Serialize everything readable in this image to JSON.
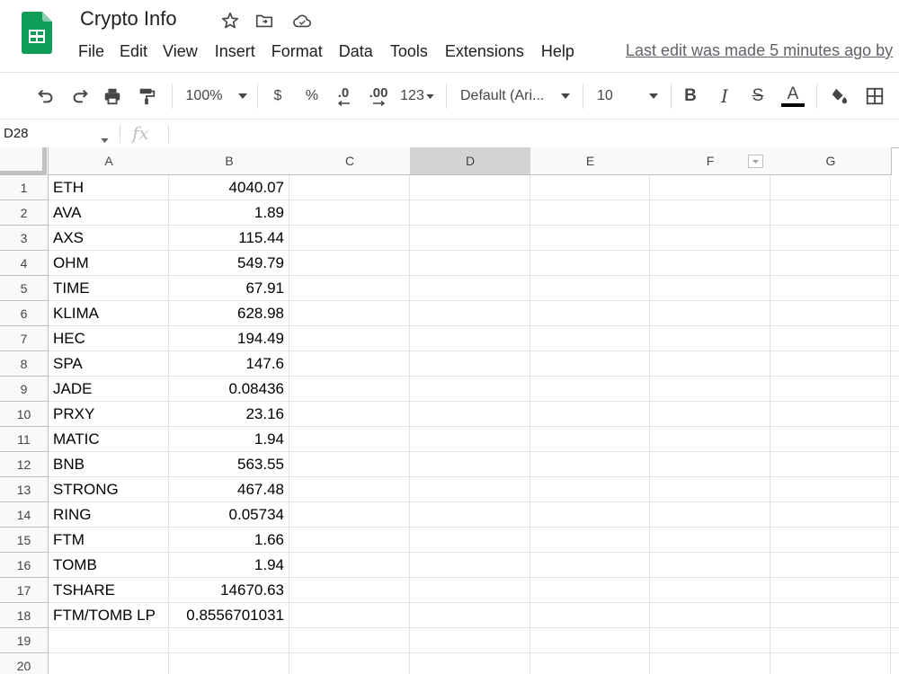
{
  "app": {
    "title": "Crypto Info",
    "last_edit": "Last edit was made 5 minutes ago by"
  },
  "menu": [
    "File",
    "Edit",
    "View",
    "Insert",
    "Format",
    "Data",
    "Tools",
    "Extensions",
    "Help"
  ],
  "toolbar": {
    "zoom": "100%",
    "currency": "$",
    "percent": "%",
    "decrease_decimal": ".0",
    "increase_decimal": ".00",
    "more_formats": "123",
    "font": "Default (Ari...",
    "font_size": "10",
    "bold": "B",
    "italic": "I",
    "strikethrough": "S",
    "text_color_letter": "A"
  },
  "formula_bar": {
    "name_box": "D28",
    "fx": "fx",
    "value": ""
  },
  "columns": [
    "A",
    "B",
    "C",
    "D",
    "E",
    "F",
    "G"
  ],
  "selected_column": "D",
  "row_numbers": [
    "1",
    "2",
    "3",
    "4",
    "5",
    "6",
    "7",
    "8",
    "9",
    "10",
    "11",
    "12",
    "13",
    "14",
    "15",
    "16",
    "17",
    "18",
    "19",
    "20"
  ],
  "rows": [
    {
      "a": "ETH",
      "b": "4040.07"
    },
    {
      "a": "AVA",
      "b": "1.89"
    },
    {
      "a": "AXS",
      "b": "115.44"
    },
    {
      "a": "OHM",
      "b": "549.79"
    },
    {
      "a": "TIME",
      "b": "67.91"
    },
    {
      "a": "KLIMA",
      "b": "628.98"
    },
    {
      "a": "HEC",
      "b": "194.49"
    },
    {
      "a": "SPA",
      "b": "147.6"
    },
    {
      "a": "JADE",
      "b": "0.08436"
    },
    {
      "a": "PRXY",
      "b": "23.16"
    },
    {
      "a": "MATIC",
      "b": "1.94"
    },
    {
      "a": "BNB",
      "b": "563.55"
    },
    {
      "a": "STRONG",
      "b": "467.48"
    },
    {
      "a": "RING",
      "b": "0.05734"
    },
    {
      "a": "FTM",
      "b": "1.66"
    },
    {
      "a": "TOMB",
      "b": "1.94"
    },
    {
      "a": "TSHARE",
      "b": "14670.63"
    },
    {
      "a": "FTM/TOMB LP",
      "b": "0.8556701031"
    },
    {
      "a": "",
      "b": ""
    },
    {
      "a": "",
      "b": ""
    }
  ],
  "colors": {
    "sheets_green": "#0f9d58",
    "header_bg": "#f8f9fa",
    "selected_col_bg": "#d3d3d3",
    "gridline": "#e2e2e2"
  }
}
